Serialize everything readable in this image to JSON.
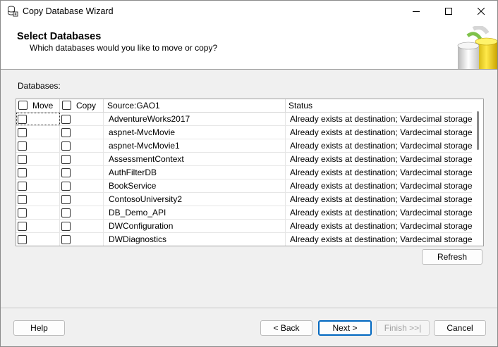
{
  "window": {
    "title": "Copy Database Wizard"
  },
  "header": {
    "title": "Select Databases",
    "subtitle": "Which databases would you like to move or copy?"
  },
  "databases_label": "Databases:",
  "grid": {
    "columns": {
      "move": "Move",
      "copy": "Copy",
      "source": "Source:GAO1",
      "status": "Status"
    },
    "rows": [
      {
        "name": "AdventureWorks2017",
        "status": "Already exists at destination; Vardecimal storage fo...",
        "move": false,
        "copy": false
      },
      {
        "name": "aspnet-MvcMovie",
        "status": "Already exists at destination; Vardecimal storage fo...",
        "move": false,
        "copy": false
      },
      {
        "name": "aspnet-MvcMovie1",
        "status": "Already exists at destination; Vardecimal storage fo...",
        "move": false,
        "copy": false
      },
      {
        "name": "AssessmentContext",
        "status": "Already exists at destination; Vardecimal storage fo...",
        "move": false,
        "copy": false
      },
      {
        "name": "AuthFilterDB",
        "status": "Already exists at destination; Vardecimal storage fo...",
        "move": false,
        "copy": false
      },
      {
        "name": "BookService",
        "status": "Already exists at destination; Vardecimal storage fo...",
        "move": false,
        "copy": false
      },
      {
        "name": "ContosoUniversity2",
        "status": "Already exists at destination; Vardecimal storage fo...",
        "move": false,
        "copy": false
      },
      {
        "name": "DB_Demo_API",
        "status": "Already exists at destination; Vardecimal storage fo...",
        "move": false,
        "copy": false
      },
      {
        "name": "DWConfiguration",
        "status": "Already exists at destination; Vardecimal storage fo...",
        "move": false,
        "copy": false
      },
      {
        "name": "DWDiagnostics",
        "status": "Already exists at destination; Vardecimal storage fo...",
        "move": false,
        "copy": false
      }
    ]
  },
  "buttons": {
    "refresh": "Refresh",
    "help": "Help",
    "back": "< Back",
    "next": "Next >",
    "finish": "Finish >>|",
    "cancel": "Cancel"
  },
  "colors": {
    "accent": "#0067c0",
    "window_bg": "#f0f0f0",
    "header_bg": "#ffffff"
  },
  "icons": {
    "title": "database-wizard-icon",
    "header_graphic": "database-cylinders-icon"
  }
}
